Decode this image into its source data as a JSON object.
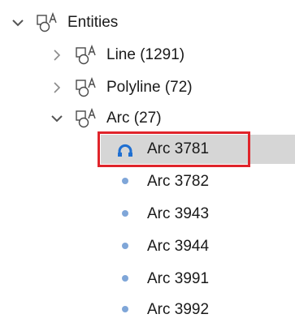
{
  "tree": {
    "root": {
      "label": "Entities",
      "expanded": true,
      "icon": "entity-group-icon"
    },
    "groups": [
      {
        "label": "Line (1291)",
        "expanded": false,
        "icon": "entity-group-icon"
      },
      {
        "label": "Polyline (72)",
        "expanded": false,
        "icon": "entity-group-icon"
      },
      {
        "label": "Arc (27)",
        "expanded": true,
        "icon": "entity-group-icon"
      }
    ],
    "arc_items": [
      {
        "label": "Arc 3781",
        "selected": true,
        "icon": "arc-icon"
      },
      {
        "label": "Arc 3782",
        "selected": false,
        "icon": "bullet-icon"
      },
      {
        "label": "Arc 3943",
        "selected": false,
        "icon": "bullet-icon"
      },
      {
        "label": "Arc 3944",
        "selected": false,
        "icon": "bullet-icon"
      },
      {
        "label": "Arc 3991",
        "selected": false,
        "icon": "bullet-icon"
      },
      {
        "label": "Arc 3992",
        "selected": false,
        "icon": "bullet-icon"
      }
    ]
  },
  "colors": {
    "selection_background": "#d6d6d6",
    "highlight_border": "#e0242b",
    "arc_icon": "#1f6fd1",
    "bullet": "#7fa6d8",
    "chevron": "#555555"
  }
}
